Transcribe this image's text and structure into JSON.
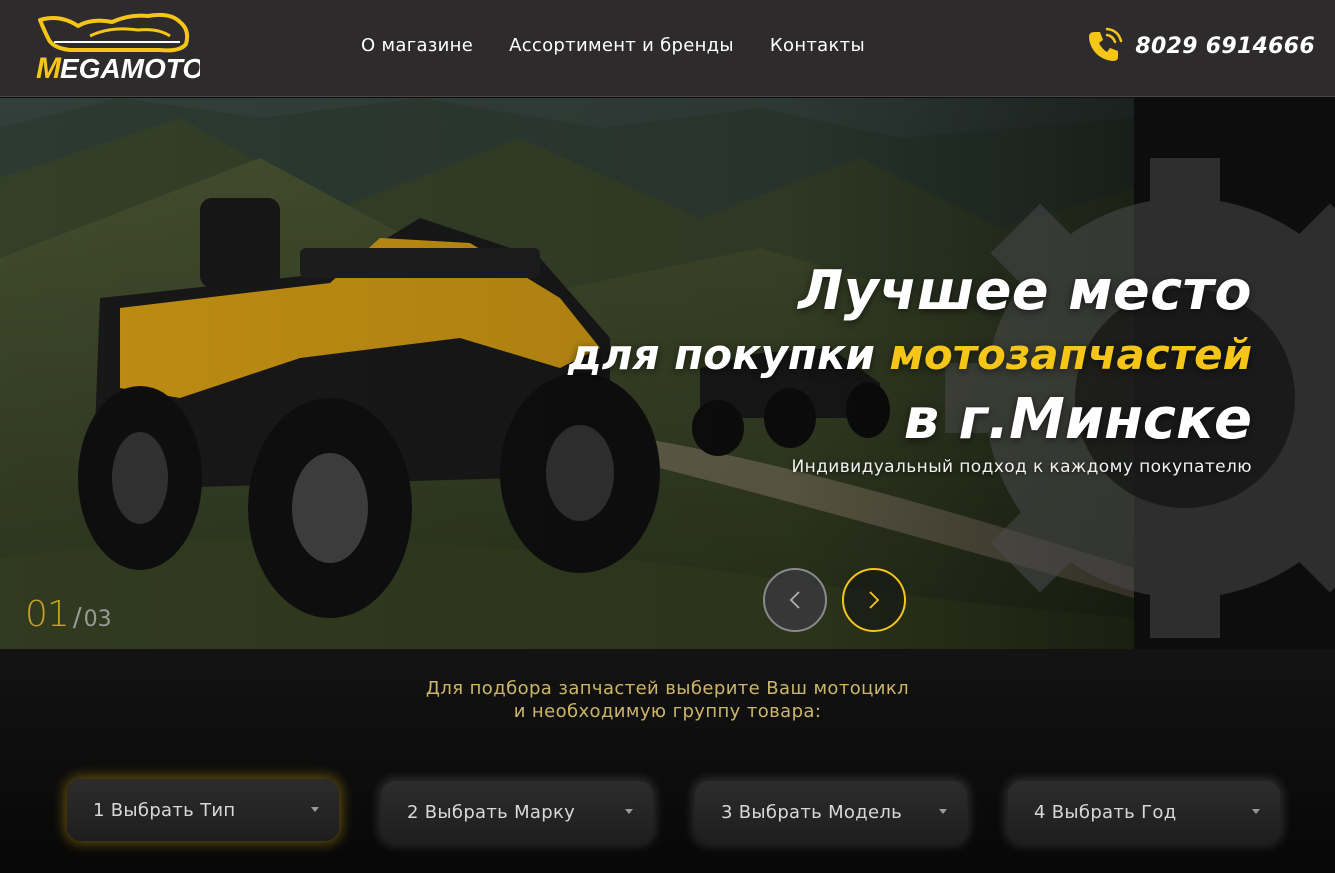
{
  "header": {
    "logo_text": "MEGAMOTO",
    "nav": [
      {
        "label": "О магазине"
      },
      {
        "label": "Ассортимент и бренды"
      },
      {
        "label": "Контакты"
      }
    ],
    "phone": "8029 6914666"
  },
  "hero": {
    "title_line1": "Лучшее место",
    "title_line2_white": "для покупки ",
    "title_line2_accent": "мотозапчастей",
    "title_line3": "в г.Минске",
    "subtitle": "Индивидуальный подход к каждому покупателю",
    "slide_current": "01",
    "slide_separator": "/",
    "slide_total": "03"
  },
  "selector": {
    "prompt_line1": "Для подбора запчастей выберите Ваш мотоцикл",
    "prompt_line2": "и необходимую группу товара:",
    "dropdowns": [
      {
        "label": "1 Выбрать Тип"
      },
      {
        "label": "2 Выбрать Марку"
      },
      {
        "label": "3 Выбрать Модель"
      },
      {
        "label": "4 Выбрать Год"
      }
    ]
  },
  "colors": {
    "accent": "#f5c518",
    "header_bg": "#2e2b2c",
    "page_bg": "#0c0c0c",
    "prompt_text": "#cdb56a"
  },
  "icons": {
    "phone": "phone-icon",
    "prev": "chevron-left-icon",
    "next": "chevron-right-icon",
    "dropdown": "caret-down-icon",
    "gear": "gear-icon"
  }
}
